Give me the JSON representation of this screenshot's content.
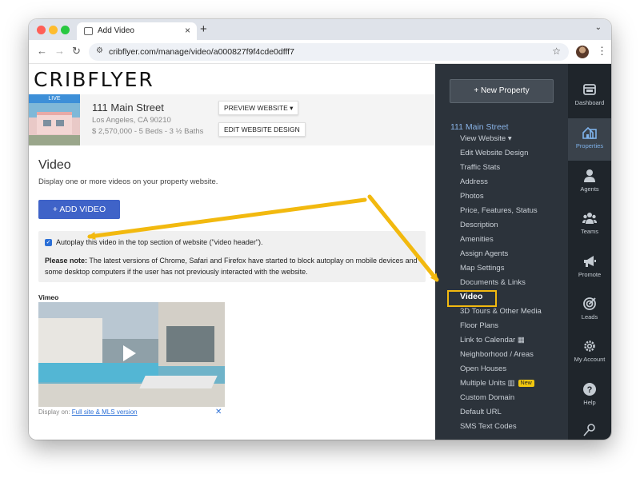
{
  "browser": {
    "tab_title": "Add Video",
    "url": "cribflyer.com/manage/video/a000827f9f4cde0dfff7"
  },
  "brand": "CRIBFLYER",
  "property": {
    "badge": "LIVE",
    "title": "111 Main Street",
    "city": "Los Angeles, CA 90210",
    "stats": "$ 2,570,000 - 5 Beds - 3 ½ Baths",
    "preview_button": "PREVIEW WEBSITE ▾",
    "edit_button": "EDIT WEBSITE DESIGN"
  },
  "video_section": {
    "title": "Video",
    "description": "Display one or more videos on your property website.",
    "add_button": "+ ADD VIDEO",
    "autoplay_label": "Autoplay this video in the top section of website (\"video header\").",
    "note_bold": "Please note:",
    "note_text": " The latest versions of Chrome, Safari and Firefox have started to block autoplay on mobile devices and some desktop computers if the user has not previously interacted with the website.",
    "video_source": "Vimeo",
    "display_on_label": "Display on: ",
    "display_on_link": "Full site & MLS version"
  },
  "sidebar": {
    "new_property": "+ New Property",
    "property_link": "111 Main Street",
    "items": [
      "View Website ▾",
      "Edit Website Design",
      "Traffic Stats",
      "Address",
      "Photos",
      "Price, Features, Status",
      "Description",
      "Amenities",
      "Assign Agents",
      "Map Settings",
      "Documents & Links",
      "Video",
      "3D Tours & Other Media",
      "Floor Plans",
      "Link to Calendar",
      "Neighborhood / Areas",
      "Open Houses",
      "Multiple Units",
      "Custom Domain",
      "Default URL",
      "SMS Text Codes"
    ],
    "new_badge": "New",
    "active_item": "Video"
  },
  "rail": {
    "items": [
      "Dashboard",
      "Properties",
      "Agents",
      "Teams",
      "Promote",
      "Leads",
      "My Account",
      "Help"
    ],
    "active": "Properties"
  },
  "colors": {
    "accent_blue": "#3f63c8",
    "annotation_yellow": "#f2b90f",
    "sidebar_bg": "#2c333b"
  }
}
